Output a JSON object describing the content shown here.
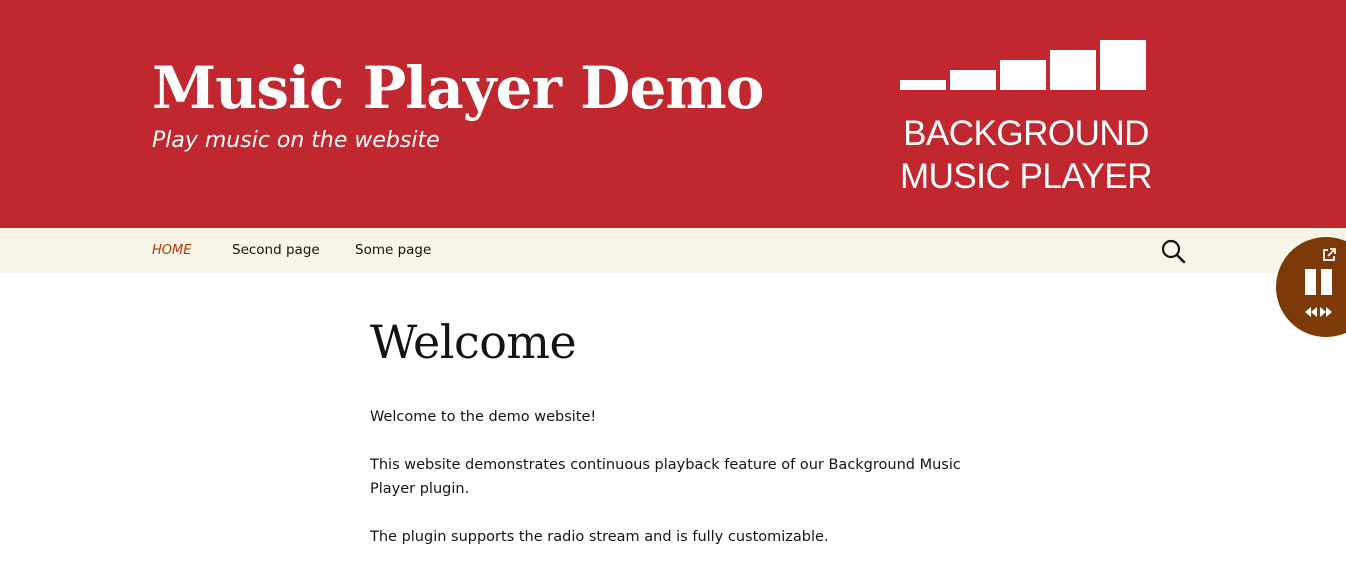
{
  "header": {
    "site_title": "Music Player Demo",
    "tagline": "Play music on the website",
    "brand_logo": {
      "line1": "BACKGROUND",
      "line2": "MUSIC PLAYER"
    }
  },
  "nav": {
    "items": [
      {
        "label": "HOME",
        "active": true
      },
      {
        "label": "Second page",
        "active": false
      },
      {
        "label": "Some page",
        "active": false
      }
    ],
    "search_icon": "search-icon"
  },
  "player": {
    "icons": [
      "popout-icon",
      "pause-icon",
      "previous-track-icon",
      "next-track-icon"
    ]
  },
  "content": {
    "title": "Welcome",
    "paragraphs": [
      "Welcome to the demo website!",
      "This website demonstrates continuous playback feature of our Background Music Player plugin.",
      "The plugin supports the radio stream and is fully customizable."
    ]
  },
  "colors": {
    "header_bg": "#c1272f",
    "nav_bg": "#f7f5e7",
    "nav_active": "#bc360a",
    "player_bg": "#7b3a07",
    "text": "#141412"
  }
}
